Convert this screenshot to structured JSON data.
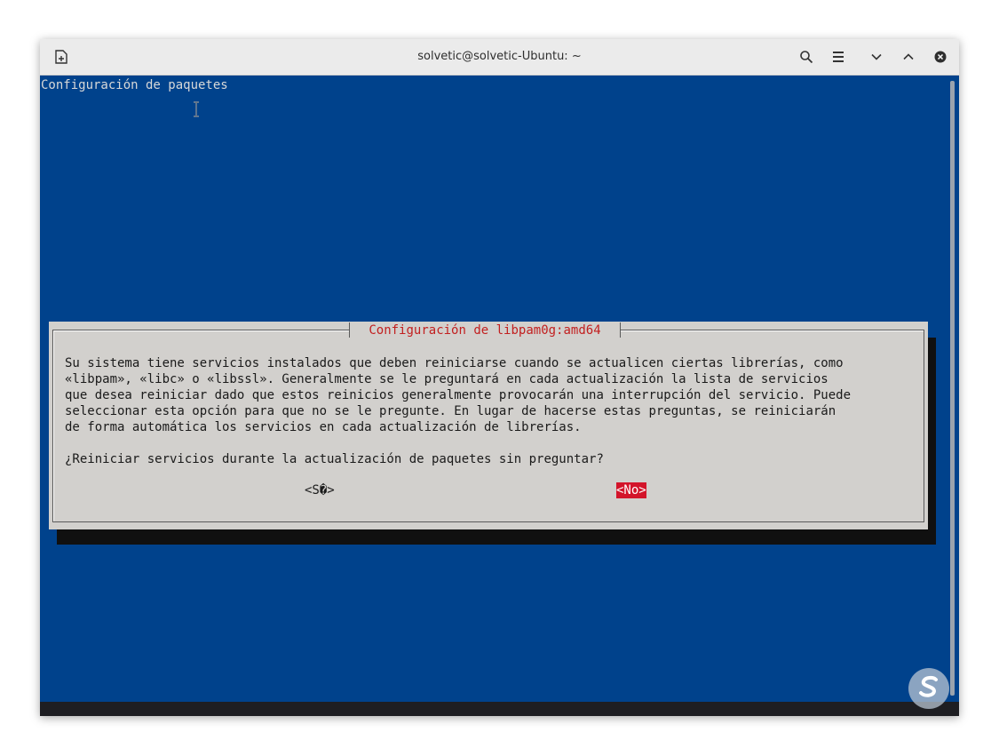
{
  "window": {
    "title": "solvetic@solvetic-Ubuntu: ~",
    "buttons": [
      "new-tab-icon",
      "search-icon",
      "menu-icon",
      "minimize-icon",
      "maximize-icon",
      "close-icon"
    ]
  },
  "terminal": {
    "heading": "Configuración de paquetes",
    "background_color": "#00428c"
  },
  "dialog": {
    "title": "Configuración de libpam0g:amd64",
    "title_color": "#c21f1f",
    "body_lines": [
      "Su sistema tiene servicios instalados que deben reiniciarse cuando se actualicen ciertas librerías, como",
      "«libpam», «libc» o «libssl». Generalmente se le preguntará en cada actualización la lista de servicios",
      "que desea reiniciar dado que estos reinicios generalmente provocarán una interrupción del servicio. Puede",
      "seleccionar esta opción para que no se le pregunte. En lugar de hacerse estas preguntas, se reiniciarán",
      "de forma automática los servicios en cada actualización de librerías."
    ],
    "question": "¿Reiniciar servicios durante la actualización de paquetes sin preguntar?",
    "yes_label": "<S�>",
    "no_label": "<No>",
    "selected_button_color": "#d3142a"
  },
  "watermark": {
    "icon": "solvetic-logo-icon"
  }
}
